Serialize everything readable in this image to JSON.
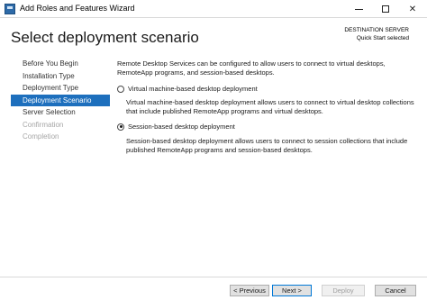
{
  "window": {
    "title": "Add Roles and Features Wizard",
    "minimize_icon": "minimize-icon",
    "maximize_icon": "maximize-icon",
    "close_icon": "close-icon"
  },
  "header": {
    "page_title": "Select deployment scenario",
    "destination_label": "DESTINATION SERVER",
    "destination_value": "Quick Start selected"
  },
  "nav": {
    "items": [
      {
        "label": "Before You Begin",
        "state": "normal"
      },
      {
        "label": "Installation Type",
        "state": "normal"
      },
      {
        "label": "Deployment Type",
        "state": "normal"
      },
      {
        "label": "Deployment Scenario",
        "state": "selected"
      },
      {
        "label": "Server Selection",
        "state": "normal"
      },
      {
        "label": "Confirmation",
        "state": "disabled"
      },
      {
        "label": "Completion",
        "state": "disabled"
      }
    ]
  },
  "content": {
    "intro": "Remote Desktop Services can be configured to allow users to connect to virtual desktops, RemoteApp programs, and session-based desktops.",
    "options": [
      {
        "label": "Virtual machine-based desktop deployment",
        "checked": false,
        "description": "Virtual machine-based desktop deployment allows users to connect to virtual desktop collections that include published RemoteApp programs and virtual desktops."
      },
      {
        "label": "Session-based desktop deployment",
        "checked": true,
        "description": "Session-based desktop deployment allows users to connect to session collections that include published RemoteApp programs and session-based desktops."
      }
    ]
  },
  "footer": {
    "previous": "< Previous",
    "next": "Next >",
    "deploy": "Deploy",
    "cancel": "Cancel"
  },
  "colors": {
    "accent": "#1d6fbd",
    "disabled_text": "#a6a6a6"
  }
}
